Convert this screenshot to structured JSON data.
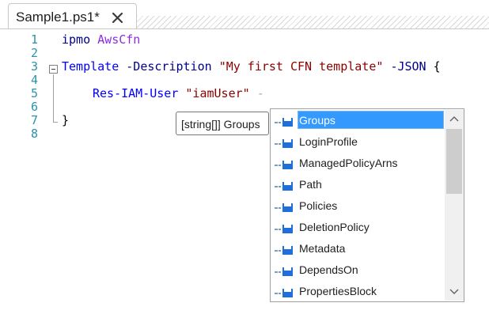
{
  "tab": {
    "title": "Sample1.ps1*",
    "close_icon": "close-icon"
  },
  "editor": {
    "lines": [
      {
        "number": "1"
      },
      {
        "number": "2"
      },
      {
        "number": "3"
      },
      {
        "number": "4"
      },
      {
        "number": "5"
      },
      {
        "number": "6"
      },
      {
        "number": "7"
      },
      {
        "number": "8"
      }
    ],
    "line1": {
      "kw": "ipmo",
      "arg": "AwsCfn"
    },
    "line3": {
      "cmd": "Template",
      "param1": "-Description",
      "str": "\"My first CFN template\"",
      "param2": "-JSON",
      "brace": "{"
    },
    "line5": {
      "cmd": "Res-IAM-User",
      "str": "\"iamUser\"",
      "op": "-"
    },
    "line7": {
      "brace": "}"
    }
  },
  "tooltip": {
    "text": "[string[]] Groups"
  },
  "completion": {
    "items": [
      {
        "label": "Groups"
      },
      {
        "label": "LoginProfile"
      },
      {
        "label": "ManagedPolicyArns"
      },
      {
        "label": "Path"
      },
      {
        "label": "Policies"
      },
      {
        "label": "DeletionPolicy"
      },
      {
        "label": "Metadata"
      },
      {
        "label": "DependsOn"
      },
      {
        "label": "PropertiesBlock"
      }
    ],
    "selected_index": 0,
    "colors": {
      "selection": "#3399ff",
      "icon": "#1e6fd9"
    }
  }
}
